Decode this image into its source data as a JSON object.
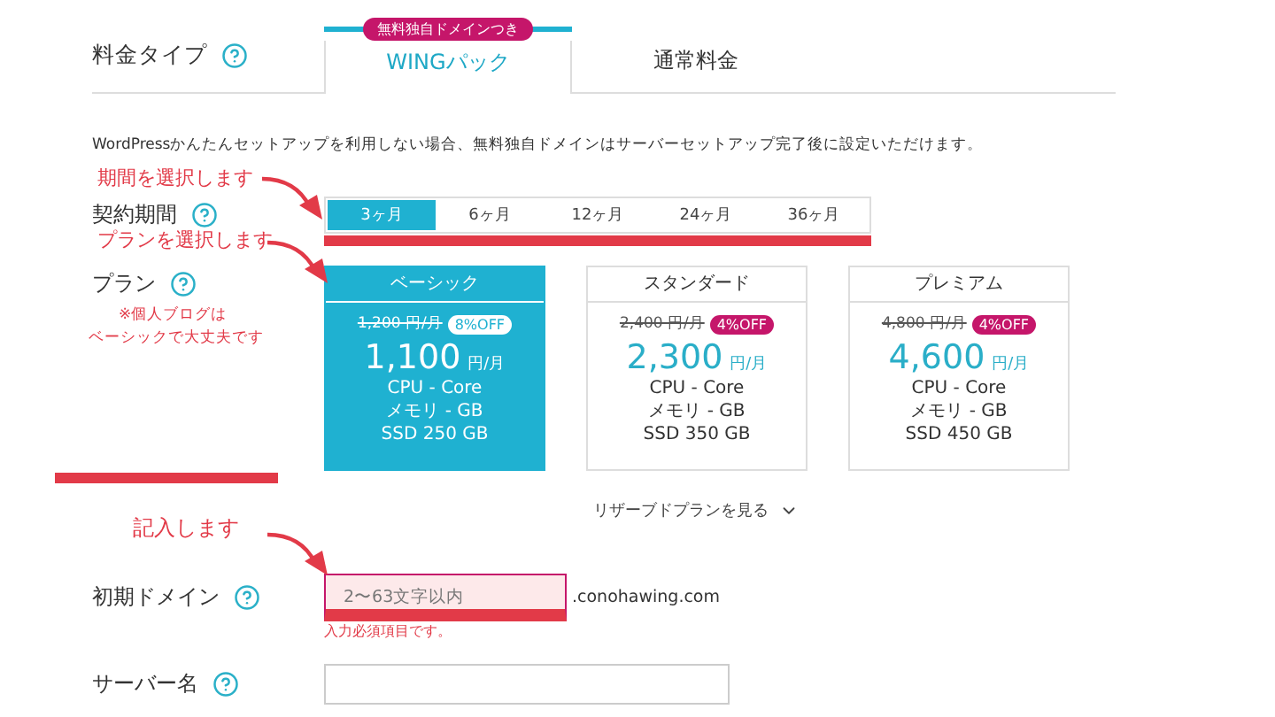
{
  "pricing_type": {
    "label": "料金タイプ",
    "tabs": [
      {
        "label": "WINGパック",
        "badge": "無料独自ドメインつき",
        "selected": true
      },
      {
        "label": "通常料金",
        "selected": false
      }
    ]
  },
  "notice": "WordPressかんたんセットアップを利用しない場合、無料独自ドメインはサーバーセットアップ完了後に設定いただけます。",
  "contract_period": {
    "label": "契約期間",
    "options": [
      {
        "label": "3ヶ月",
        "selected": true
      },
      {
        "label": "6ヶ月",
        "selected": false
      },
      {
        "label": "12ヶ月",
        "selected": false
      },
      {
        "label": "24ヶ月",
        "selected": false
      },
      {
        "label": "36ヶ月",
        "selected": false
      }
    ]
  },
  "plan": {
    "label": "プラン",
    "plans": [
      {
        "name": "ベーシック",
        "list_price": "1,200 円/月",
        "discount": "8%OFF",
        "price": "1,100",
        "unit": "円/月",
        "specs": [
          "CPU - Core",
          "メモリ - GB",
          "SSD 250 GB"
        ],
        "selected": true
      },
      {
        "name": "スタンダード",
        "list_price": "2,400 円/月",
        "discount": "4%OFF",
        "price": "2,300",
        "unit": "円/月",
        "specs": [
          "CPU - Core",
          "メモリ - GB",
          "SSD 350 GB"
        ],
        "selected": false
      },
      {
        "name": "プレミアム",
        "list_price": "4,800 円/月",
        "discount": "4%OFF",
        "price": "4,600",
        "unit": "円/月",
        "specs": [
          "CPU - Core",
          "メモリ - GB",
          "SSD 450 GB"
        ],
        "selected": false
      }
    ]
  },
  "reserved_link": "リザーブドプランを見る",
  "initial_domain": {
    "label": "初期ドメイン",
    "placeholder": "2〜63文字以内",
    "suffix": ".conohawing.com",
    "error": "入力必須項目です。"
  },
  "server_name": {
    "label": "サーバー名"
  },
  "annotations": [
    {
      "text": "期間を選択します"
    },
    {
      "text": "プランを選択します"
    },
    {
      "text": "※個人ブログは"
    },
    {
      "text": "ベーシックで大丈夫です"
    },
    {
      "text": "記入します"
    }
  ]
}
